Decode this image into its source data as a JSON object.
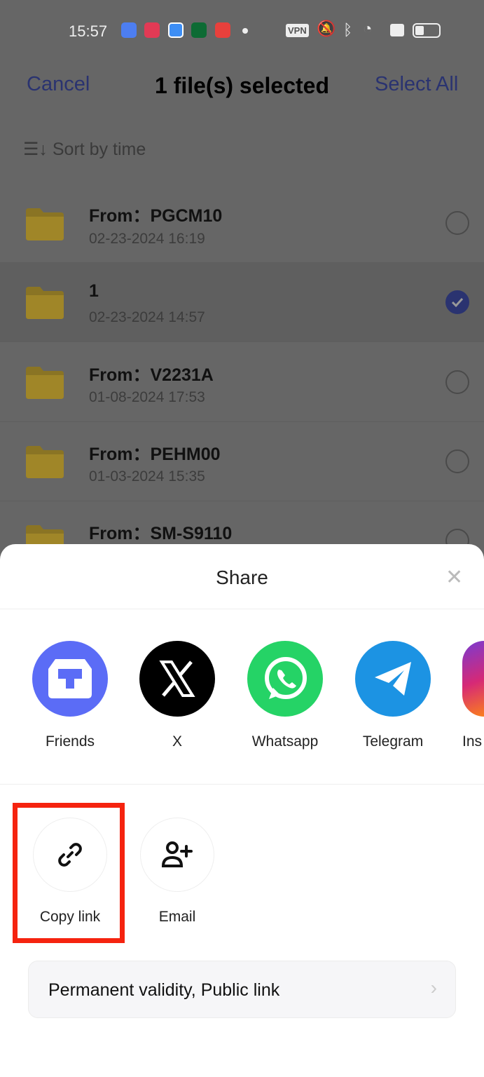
{
  "status_bar": {
    "time": "15:57",
    "vpn": "VPN"
  },
  "header": {
    "cancel": "Cancel",
    "title": "1 file(s) selected",
    "select_all": "Select All"
  },
  "sort": {
    "label": "Sort by time"
  },
  "files": [
    {
      "name": "From：PGCM10",
      "date": "02-23-2024  16:19",
      "selected": false
    },
    {
      "name": "1",
      "date": "02-23-2024  14:57",
      "selected": true
    },
    {
      "name": "From：V2231A",
      "date": "01-08-2024  17:53",
      "selected": false
    },
    {
      "name": "From：PEHM00",
      "date": "01-03-2024  15:35",
      "selected": false
    },
    {
      "name": "From：SM-S9110",
      "date": "",
      "selected": false
    }
  ],
  "share": {
    "title": "Share",
    "apps": [
      {
        "label": "Friends",
        "color": "#5b6cf6"
      },
      {
        "label": "X",
        "color": "#000000"
      },
      {
        "label": "Whatsapp",
        "color": "#25d366"
      },
      {
        "label": "Telegram",
        "color": "#1c93e3"
      },
      {
        "label": "Ins",
        "color": "#d62976"
      }
    ],
    "actions": [
      {
        "label": "Copy link",
        "icon": "link-icon"
      },
      {
        "label": "Email",
        "icon": "add-person-icon"
      }
    ],
    "link_setting": "Permanent validity, Public link"
  },
  "colors": {
    "accent": "#2a3370",
    "highlight": "#f5230f"
  }
}
